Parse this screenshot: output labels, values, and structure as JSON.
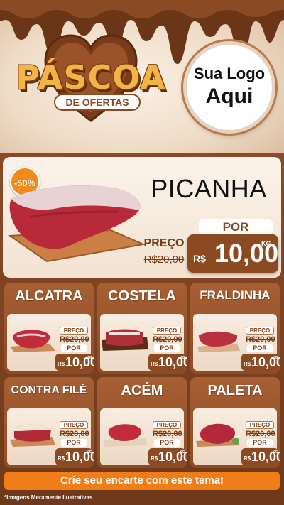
{
  "header": {
    "title": "PÁSCOA",
    "subtitle": "DE OFERTAS",
    "logo_line1": "Sua Logo",
    "logo_line2": "Aqui"
  },
  "hero": {
    "badge": "-50%",
    "name": "PICANHA",
    "por_label": "POR",
    "preco_label": "PREÇO",
    "old_price": "R$20,00",
    "currency": "R$",
    "price": "10,00",
    "unit": "KG"
  },
  "products": [
    {
      "name": "ALCATRA",
      "preco_label": "PREÇO",
      "old_price": "R$20,00",
      "por_label": "POR",
      "currency": "R$",
      "price": "10,00",
      "unit": "KG"
    },
    {
      "name": "COSTELA",
      "preco_label": "PREÇO",
      "old_price": "R$20,00",
      "por_label": "POR",
      "currency": "R$",
      "price": "10,00",
      "unit": "KG"
    },
    {
      "name": "FRALDINHA",
      "preco_label": "PREÇO",
      "old_price": "R$20,00",
      "por_label": "POR",
      "currency": "R$",
      "price": "10,00",
      "unit": "KG"
    },
    {
      "name": "CONTRA FILÉ",
      "preco_label": "PREÇO",
      "old_price": "R$20,00",
      "por_label": "POR",
      "currency": "R$",
      "price": "10,00",
      "unit": "KG"
    },
    {
      "name": "ACÉM",
      "preco_label": "PREÇO",
      "old_price": "R$20,00",
      "por_label": "POR",
      "currency": "R$",
      "price": "10,00",
      "unit": "KG"
    },
    {
      "name": "PALETA",
      "preco_label": "PREÇO",
      "old_price": "R$20,00",
      "por_label": "POR",
      "currency": "R$",
      "price": "10,00",
      "unit": "KG"
    }
  ],
  "cta": "Crie seu encarte com este tema!",
  "disclaimer": "*Imagens Meramente Ilustrativas",
  "colors": {
    "brown": "#8b4a22",
    "orange": "#f07d18",
    "gold": "#f2b347",
    "cream": "#f8ede2"
  }
}
